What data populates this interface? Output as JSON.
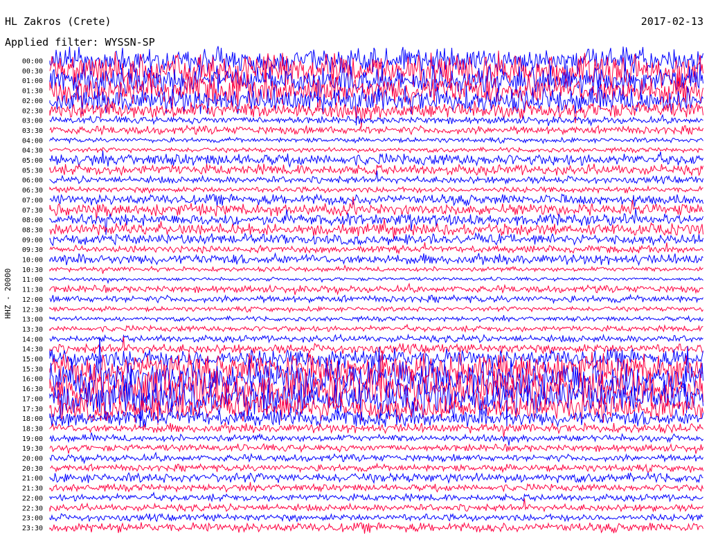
{
  "header": {
    "station": "HL Zakros (Crete)",
    "date": "2017-02-13",
    "filter": "Applied filter: WYSSN-SP"
  },
  "chart_data": {
    "type": "line",
    "channel_label": "HHZ - 20000",
    "row_labels": [
      "00:00",
      "00:30",
      "01:00",
      "01:30",
      "02:00",
      "02:30",
      "03:00",
      "03:30",
      "04:00",
      "04:30",
      "05:00",
      "05:30",
      "06:00",
      "06:30",
      "07:00",
      "07:30",
      "08:00",
      "08:30",
      "09:00",
      "09:30",
      "10:00",
      "10:30",
      "11:00",
      "11:30",
      "12:00",
      "12:30",
      "13:00",
      "13:30",
      "14:00",
      "14:30",
      "15:00",
      "15:30",
      "16:00",
      "16:30",
      "17:00",
      "17:30",
      "18:00",
      "18:30",
      "19:00",
      "19:30",
      "20:00",
      "20:30",
      "21:00",
      "21:30",
      "22:00",
      "22:30",
      "23:00",
      "23:30"
    ],
    "row_amplitude": [
      22,
      28,
      24,
      26,
      22,
      14,
      6,
      7,
      4,
      4,
      10,
      9,
      6,
      5,
      9,
      10,
      10,
      10,
      9,
      6,
      9,
      4,
      3,
      6,
      6,
      4,
      4,
      5,
      6,
      8,
      16,
      26,
      32,
      34,
      30,
      22,
      14,
      8,
      6,
      6,
      6,
      6,
      8,
      6,
      6,
      6,
      6,
      8
    ],
    "colors": {
      "even_rows": "#0000ff",
      "odd_rows": "#ff0040"
    }
  }
}
